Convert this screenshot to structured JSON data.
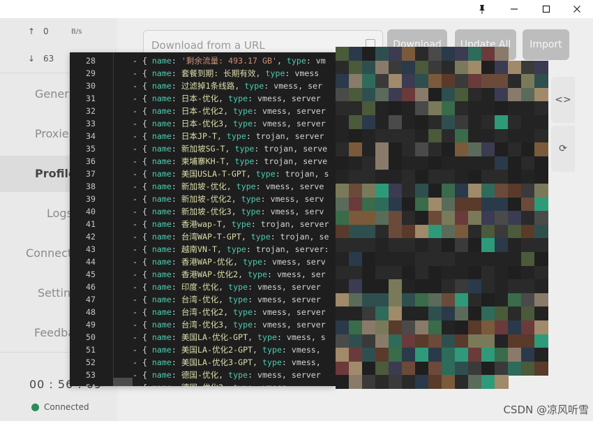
{
  "window": {
    "pin_icon": "pin-icon",
    "minimize_icon": "minimize-icon",
    "maximize_icon": "maximize-icon",
    "close_icon": "close-icon"
  },
  "sidebar": {
    "upload": {
      "arrow": "↑",
      "value": "0",
      "unit": "B/s"
    },
    "download": {
      "arrow": "↓",
      "value": "63"
    },
    "nav": [
      "Gener",
      "Proxie",
      "Profile",
      "Logs",
      "Connect",
      "Settin",
      "Feedba"
    ],
    "active_nav": "Profile",
    "timer": "00 : 56 : 09",
    "status": "Connected",
    "status_color": "#2e8b57"
  },
  "toolbar": {
    "url_placeholder": "Download from a URL",
    "download_label": "Download",
    "update_all_label": "Update All",
    "import_label": "Import"
  },
  "side_icons": {
    "code": "<>",
    "refresh": "⟳"
  },
  "code_lines": [
    {
      "n": "28",
      "seg": [
        [
          "p",
          "- { "
        ],
        [
          "k",
          "name"
        ],
        [
          "p",
          ": "
        ],
        [
          "s",
          "'剩余流量: 493.17 GB'"
        ],
        [
          "p",
          ", "
        ],
        [
          "k",
          "type"
        ],
        [
          "p",
          ": vm"
        ]
      ]
    },
    {
      "n": "29",
      "seg": [
        [
          "p",
          "- { "
        ],
        [
          "k",
          "name"
        ],
        [
          "p",
          ": "
        ],
        [
          "y",
          "套餐到期: 长期有效"
        ],
        [
          "p",
          ", "
        ],
        [
          "k",
          "type"
        ],
        [
          "p",
          ": vmess"
        ]
      ]
    },
    {
      "n": "30",
      "seg": [
        [
          "p",
          "- { "
        ],
        [
          "k",
          "name"
        ],
        [
          "p",
          ": "
        ],
        [
          "y",
          "过滤掉1条线路"
        ],
        [
          "p",
          ", "
        ],
        [
          "k",
          "type"
        ],
        [
          "p",
          ": vmess, ser"
        ]
      ]
    },
    {
      "n": "31",
      "seg": [
        [
          "p",
          "- { "
        ],
        [
          "k",
          "name"
        ],
        [
          "p",
          ": "
        ],
        [
          "y",
          "日本-优化"
        ],
        [
          "p",
          ", "
        ],
        [
          "k",
          "type"
        ],
        [
          "p",
          ": vmess, server"
        ]
      ]
    },
    {
      "n": "32",
      "seg": [
        [
          "p",
          "- { "
        ],
        [
          "k",
          "name"
        ],
        [
          "p",
          ": "
        ],
        [
          "y",
          "日本-优化2"
        ],
        [
          "p",
          ", "
        ],
        [
          "k",
          "type"
        ],
        [
          "p",
          ": vmess, server"
        ]
      ]
    },
    {
      "n": "33",
      "seg": [
        [
          "p",
          "- { "
        ],
        [
          "k",
          "name"
        ],
        [
          "p",
          ": "
        ],
        [
          "y",
          "日本-优化3"
        ],
        [
          "p",
          ", "
        ],
        [
          "k",
          "type"
        ],
        [
          "p",
          ": vmess, server"
        ]
      ]
    },
    {
      "n": "34",
      "seg": [
        [
          "p",
          "- { "
        ],
        [
          "k",
          "name"
        ],
        [
          "p",
          ": "
        ],
        [
          "y",
          "日本JP-T"
        ],
        [
          "p",
          ", "
        ],
        [
          "k",
          "type"
        ],
        [
          "p",
          ": trojan, server"
        ]
      ]
    },
    {
      "n": "35",
      "seg": [
        [
          "p",
          "- { "
        ],
        [
          "k",
          "name"
        ],
        [
          "p",
          ": "
        ],
        [
          "y",
          "新加坡SG-T"
        ],
        [
          "p",
          ", "
        ],
        [
          "k",
          "type"
        ],
        [
          "p",
          ": trojan, serve"
        ]
      ]
    },
    {
      "n": "36",
      "seg": [
        [
          "p",
          "- { "
        ],
        [
          "k",
          "name"
        ],
        [
          "p",
          ": "
        ],
        [
          "y",
          "柬埔寨KH-T"
        ],
        [
          "p",
          ", "
        ],
        [
          "k",
          "type"
        ],
        [
          "p",
          ": trojan, serve"
        ]
      ]
    },
    {
      "n": "37",
      "seg": [
        [
          "p",
          "- { "
        ],
        [
          "k",
          "name"
        ],
        [
          "p",
          ": "
        ],
        [
          "y",
          "美国USLA-T-GPT"
        ],
        [
          "p",
          ", "
        ],
        [
          "k",
          "type"
        ],
        [
          "p",
          ": trojan, s"
        ]
      ]
    },
    {
      "n": "38",
      "seg": [
        [
          "p",
          "- { "
        ],
        [
          "k",
          "name"
        ],
        [
          "p",
          ": "
        ],
        [
          "y",
          "新加坡-优化"
        ],
        [
          "p",
          ", "
        ],
        [
          "k",
          "type"
        ],
        [
          "p",
          ": vmess, serve"
        ]
      ]
    },
    {
      "n": "39",
      "seg": [
        [
          "p",
          "- { "
        ],
        [
          "k",
          "name"
        ],
        [
          "p",
          ": "
        ],
        [
          "y",
          "新加坡-优化2"
        ],
        [
          "p",
          ", "
        ],
        [
          "k",
          "type"
        ],
        [
          "p",
          ": vmess, serv"
        ]
      ]
    },
    {
      "n": "40",
      "seg": [
        [
          "p",
          "- { "
        ],
        [
          "k",
          "name"
        ],
        [
          "p",
          ": "
        ],
        [
          "y",
          "新加坡-优化3"
        ],
        [
          "p",
          ", "
        ],
        [
          "k",
          "type"
        ],
        [
          "p",
          ": vmess, serv"
        ]
      ]
    },
    {
      "n": "41",
      "seg": [
        [
          "p",
          "- { "
        ],
        [
          "k",
          "name"
        ],
        [
          "p",
          ": "
        ],
        [
          "y",
          "香港wap-T"
        ],
        [
          "p",
          ", "
        ],
        [
          "k",
          "type"
        ],
        [
          "p",
          ": trojan, server"
        ]
      ]
    },
    {
      "n": "42",
      "seg": [
        [
          "p",
          "- { "
        ],
        [
          "k",
          "name"
        ],
        [
          "p",
          ": "
        ],
        [
          "y",
          "台湾WAP-T-GPT"
        ],
        [
          "p",
          ", "
        ],
        [
          "k",
          "type"
        ],
        [
          "p",
          ": trojan, se"
        ]
      ]
    },
    {
      "n": "43",
      "seg": [
        [
          "p",
          "- { "
        ],
        [
          "k",
          "name"
        ],
        [
          "p",
          ": "
        ],
        [
          "y",
          "越南VN-T"
        ],
        [
          "p",
          ", "
        ],
        [
          "k",
          "type"
        ],
        [
          "p",
          ": trojan, server:"
        ]
      ]
    },
    {
      "n": "44",
      "seg": [
        [
          "p",
          "- { "
        ],
        [
          "k",
          "name"
        ],
        [
          "p",
          ": "
        ],
        [
          "y",
          "香港WAP-优化"
        ],
        [
          "p",
          ", "
        ],
        [
          "k",
          "type"
        ],
        [
          "p",
          ": vmess, serv"
        ]
      ]
    },
    {
      "n": "45",
      "seg": [
        [
          "p",
          "- { "
        ],
        [
          "k",
          "name"
        ],
        [
          "p",
          ": "
        ],
        [
          "y",
          "香港WAP-优化2"
        ],
        [
          "p",
          ", "
        ],
        [
          "k",
          "type"
        ],
        [
          "p",
          ": vmess, ser"
        ]
      ]
    },
    {
      "n": "46",
      "seg": [
        [
          "p",
          "- { "
        ],
        [
          "k",
          "name"
        ],
        [
          "p",
          ": "
        ],
        [
          "y",
          "印度-优化"
        ],
        [
          "p",
          ", "
        ],
        [
          "k",
          "type"
        ],
        [
          "p",
          ": vmess, server"
        ]
      ]
    },
    {
      "n": "47",
      "seg": [
        [
          "p",
          "- { "
        ],
        [
          "k",
          "name"
        ],
        [
          "p",
          ": "
        ],
        [
          "y",
          "台湾-优化"
        ],
        [
          "p",
          ", "
        ],
        [
          "k",
          "type"
        ],
        [
          "p",
          ": vmess, server"
        ]
      ]
    },
    {
      "n": "48",
      "seg": [
        [
          "p",
          "- { "
        ],
        [
          "k",
          "name"
        ],
        [
          "p",
          ": "
        ],
        [
          "y",
          "台湾-优化2"
        ],
        [
          "p",
          ", "
        ],
        [
          "k",
          "type"
        ],
        [
          "p",
          ": vmess, server"
        ]
      ]
    },
    {
      "n": "49",
      "seg": [
        [
          "p",
          "- { "
        ],
        [
          "k",
          "name"
        ],
        [
          "p",
          ": "
        ],
        [
          "y",
          "台湾-优化3"
        ],
        [
          "p",
          ", "
        ],
        [
          "k",
          "type"
        ],
        [
          "p",
          ": vmess, server"
        ]
      ]
    },
    {
      "n": "50",
      "seg": [
        [
          "p",
          "- { "
        ],
        [
          "k",
          "name"
        ],
        [
          "p",
          ": "
        ],
        [
          "y",
          "美国LA-优化-GPT"
        ],
        [
          "p",
          ", "
        ],
        [
          "k",
          "type"
        ],
        [
          "p",
          ": vmess, s"
        ]
      ]
    },
    {
      "n": "51",
      "seg": [
        [
          "p",
          "- { "
        ],
        [
          "k",
          "name"
        ],
        [
          "p",
          ": "
        ],
        [
          "y",
          "美国LA-优化2-GPT"
        ],
        [
          "p",
          ", "
        ],
        [
          "k",
          "type"
        ],
        [
          "p",
          ": vmess,"
        ]
      ]
    },
    {
      "n": "52",
      "seg": [
        [
          "p",
          "- { "
        ],
        [
          "k",
          "name"
        ],
        [
          "p",
          ": "
        ],
        [
          "y",
          "美国LA-优化3-GPT"
        ],
        [
          "p",
          ", "
        ],
        [
          "k",
          "type"
        ],
        [
          "p",
          ": vmess,"
        ]
      ]
    },
    {
      "n": "53",
      "seg": [
        [
          "p",
          "- { "
        ],
        [
          "k",
          "name"
        ],
        [
          "p",
          ": "
        ],
        [
          "y",
          "德国-优化"
        ],
        [
          "p",
          ", "
        ],
        [
          "k",
          "type"
        ],
        [
          "p",
          ": vmess, server"
        ]
      ]
    },
    {
      "n": "54",
      "seg": [
        [
          "p",
          "- { "
        ],
        [
          "k",
          "name"
        ],
        [
          "p",
          ": "
        ],
        [
          "y",
          "德国-优化2"
        ],
        [
          "p",
          ", "
        ],
        [
          "k",
          "type"
        ],
        [
          "p",
          ": vmess"
        ]
      ]
    }
  ],
  "watermark": "CSDN @凉风听雪"
}
